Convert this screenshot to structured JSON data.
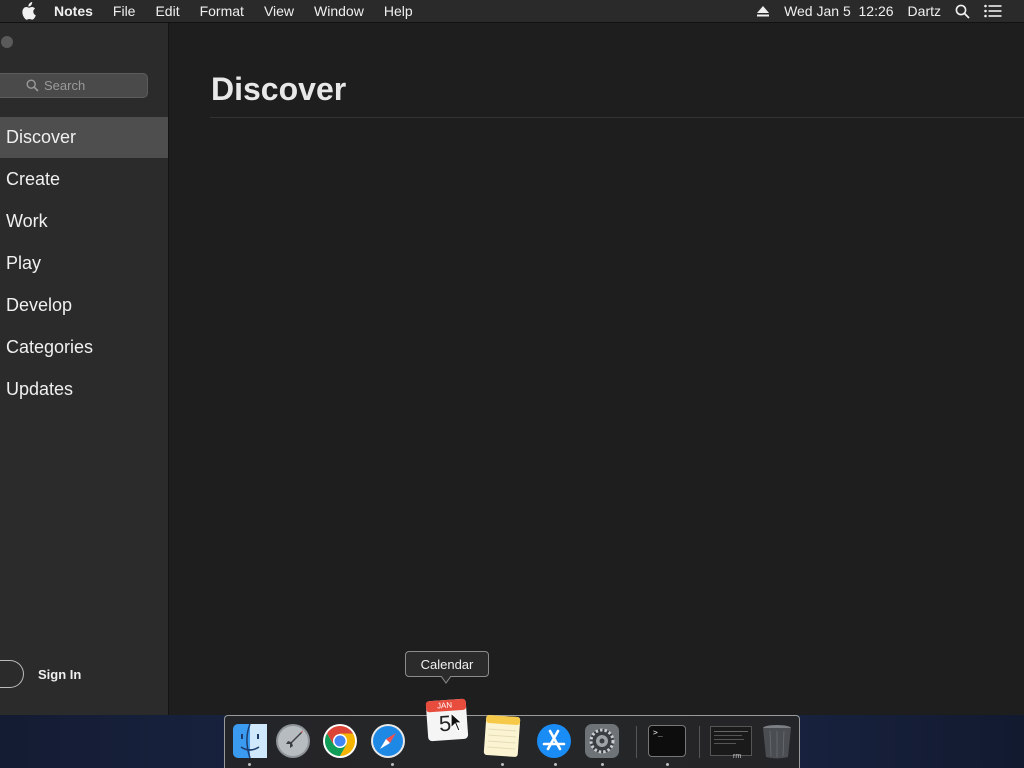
{
  "menubar": {
    "app_name": "Notes",
    "menus": [
      "File",
      "Edit",
      "Format",
      "View",
      "Window",
      "Help"
    ],
    "clock": "Wed Jan 5  12:26",
    "user": "Dartz"
  },
  "sidebar": {
    "search_placeholder": "Search",
    "items": [
      {
        "label": "Discover",
        "active": true
      },
      {
        "label": "Create"
      },
      {
        "label": "Work"
      },
      {
        "label": "Play"
      },
      {
        "label": "Develop"
      },
      {
        "label": "Categories"
      },
      {
        "label": "Updates"
      }
    ],
    "sign_in": "Sign In"
  },
  "main": {
    "title": "Discover"
  },
  "dock": {
    "tooltip": "Calendar",
    "calendar_month": "JAN",
    "calendar_day": "5",
    "terminal_prompt": ">_",
    "minimized_label": "rm"
  },
  "colors": {
    "sidebar_bg": "#2b2b2b",
    "active_item": "#4e4e4e",
    "main_bg": "#1e1e1e",
    "menubar_bg": "#2a2a2a"
  }
}
